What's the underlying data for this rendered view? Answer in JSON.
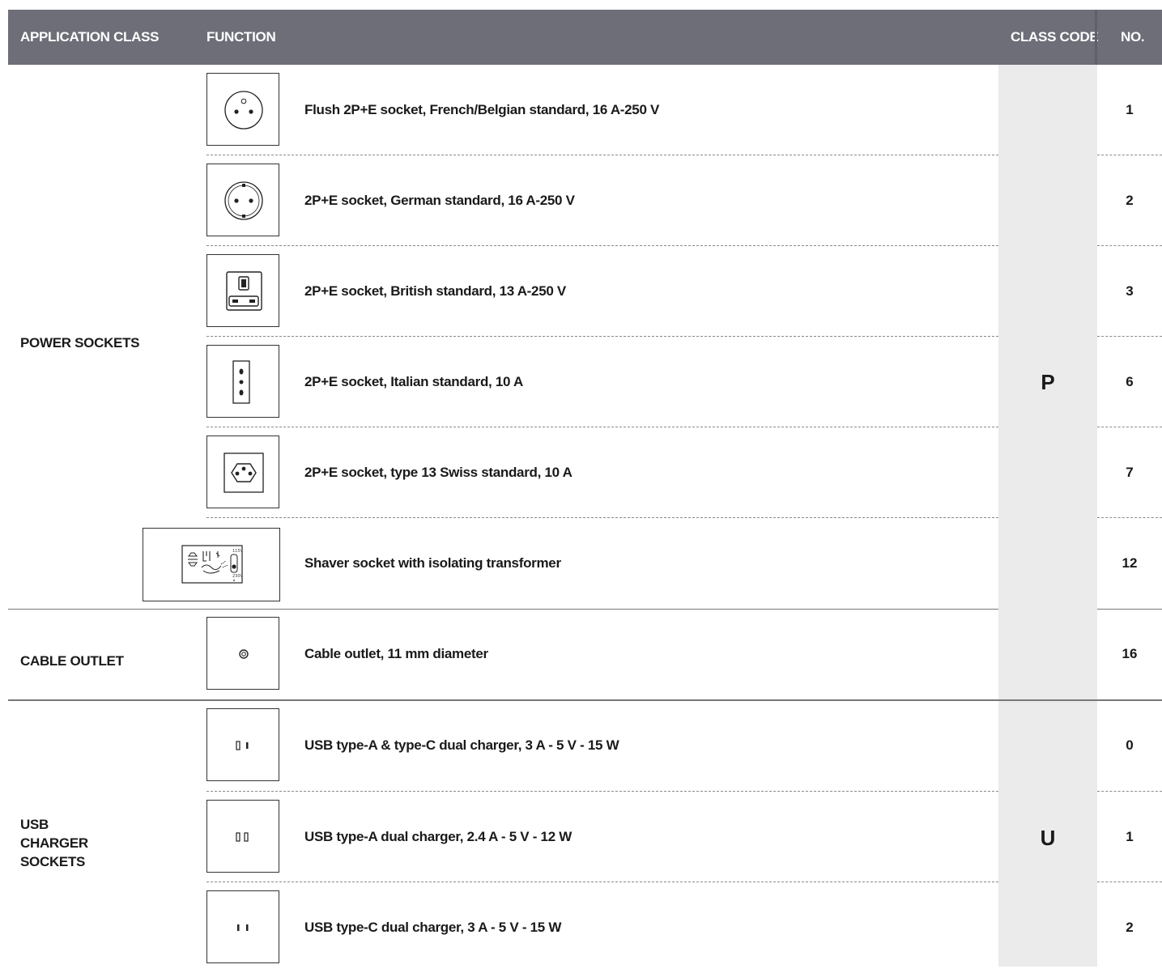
{
  "header": {
    "application_class": "APPLICATION CLASS",
    "function": "FUNCTION",
    "class_code": "CLASS CODE",
    "no": "NO."
  },
  "groups": [
    {
      "label_lines": [
        "POWER SOCKETS"
      ],
      "class_code": "P"
    },
    {
      "label_lines": [
        "CABLE OUTLET"
      ],
      "class_code": ""
    },
    {
      "label_lines": [
        "USB",
        "CHARGER",
        "SOCKETS"
      ],
      "class_code": "U"
    }
  ],
  "items": [
    {
      "icon": "french-belgian-socket-icon",
      "description": "Flush 2P+E socket, French/Belgian standard, 16 A-250 V",
      "no": "1"
    },
    {
      "icon": "german-schuko-socket-icon",
      "description": "2P+E socket, German standard, 16 A-250 V",
      "no": "2"
    },
    {
      "icon": "british-socket-icon",
      "description": "2P+E socket, British standard, 13 A-250 V",
      "no": "3"
    },
    {
      "icon": "italian-socket-icon",
      "description": "2P+E socket, Italian standard, 10 A",
      "no": "6"
    },
    {
      "icon": "swiss-socket-icon",
      "description": "2P+E socket, type 13 Swiss standard, 10 A",
      "no": "7"
    },
    {
      "icon": "shaver-socket-icon",
      "description": "Shaver socket with isolating transformer",
      "no": "12",
      "shaver_marks": [
        "115V",
        "230V"
      ]
    },
    {
      "icon": "cable-outlet-icon",
      "description": "Cable outlet, 11 mm diameter",
      "no": "16"
    },
    {
      "icon": "usb-a-c-charger-icon",
      "description": "USB type-A & type-C dual charger, 3 A - 5 V - 15 W",
      "no": "0"
    },
    {
      "icon": "usb-a-dual-charger-icon",
      "description": "USB type-A dual charger, 2.4 A - 5 V - 12 W",
      "no": "1"
    },
    {
      "icon": "usb-c-dual-charger-icon",
      "description": "USB type-C dual charger, 3 A - 5 V - 15 W",
      "no": "2"
    }
  ],
  "colors": {
    "header_bg": "#6d6e78",
    "header_text": "#ffffff",
    "class_code_column_bg": "#ebebeb"
  }
}
